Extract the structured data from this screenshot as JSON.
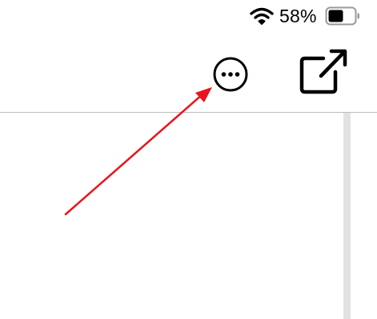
{
  "status_bar": {
    "battery_percent": "58%",
    "battery_level": 0.58,
    "wifi_icon": "wifi-icon",
    "battery_icon": "battery-icon"
  },
  "toolbar": {
    "more_button_icon": "ellipsis-circle-icon",
    "share_button_icon": "share-external-icon"
  },
  "annotation": {
    "type": "arrow",
    "color": "#e8141c",
    "points_to": "more-button"
  },
  "colors": {
    "background": "#ffffff",
    "icon": "#000000",
    "divider": "#bdbdbd",
    "scrollbar": "#e2e2e2",
    "annotation_arrow": "#e8141c"
  }
}
